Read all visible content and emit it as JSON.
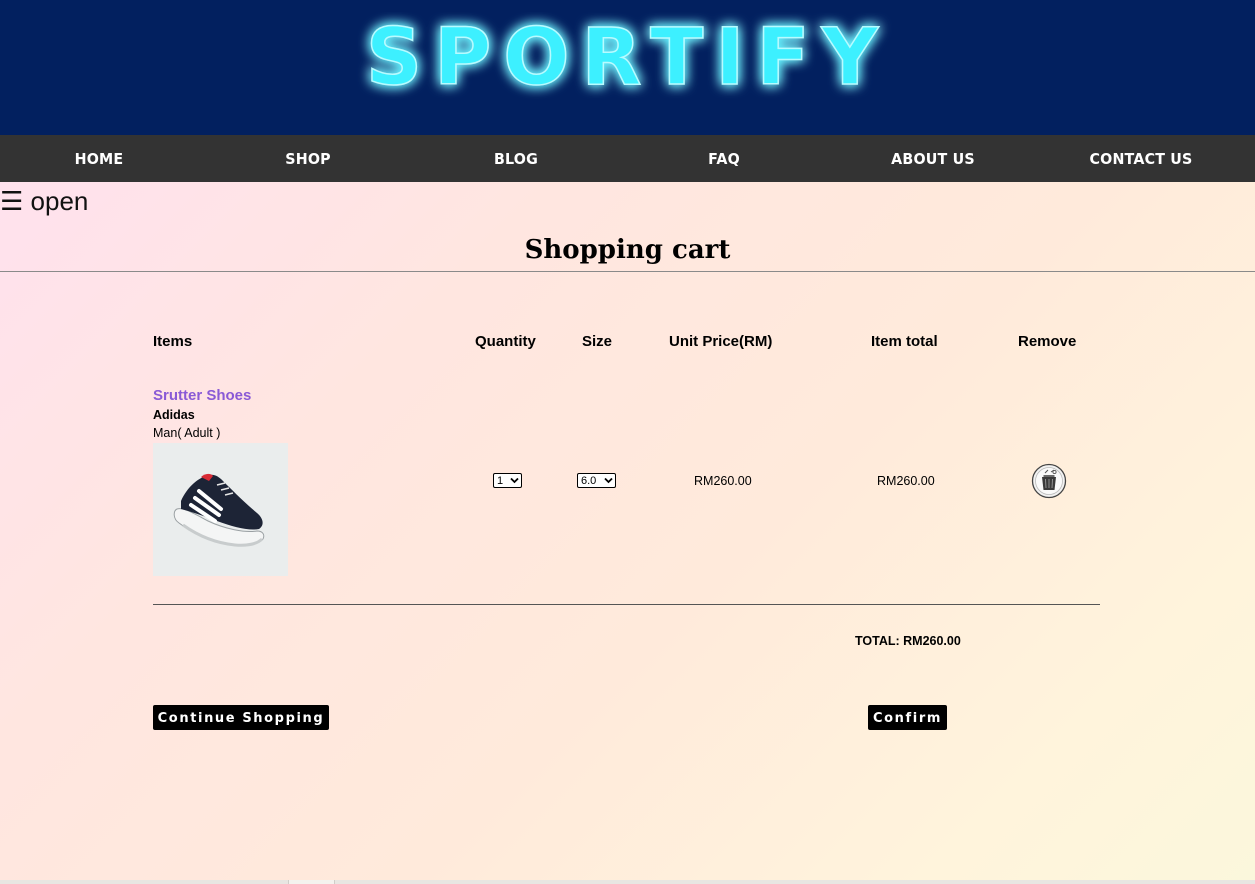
{
  "header": {
    "brand_logo_text": "SPORTIFY",
    "background_color": "#02205f",
    "logo_color": "#3ef0ff"
  },
  "nav": {
    "items": [
      {
        "label": "HOME"
      },
      {
        "label": "SHOP"
      },
      {
        "label": "BLOG"
      },
      {
        "label": "FAQ"
      },
      {
        "label": "ABOUT US"
      },
      {
        "label": "CONTACT US"
      }
    ],
    "background_color": "#333333"
  },
  "sidebar_toggle": {
    "label": "☰ open"
  },
  "page": {
    "title": "Shopping cart"
  },
  "cart": {
    "columns": [
      "Items",
      "Quantity",
      "Size",
      "Unit Price(RM)",
      "Item total",
      "Remove"
    ],
    "items": [
      {
        "name": "Srutter Shoes",
        "brand": "Adidas",
        "category": "Man( Adult )",
        "image_icon": "sneaker-image",
        "quantity": "1",
        "size": "6.0",
        "unit_price": "RM260.00",
        "item_total": "RM260.00",
        "remove_icon": "trash-bin-icon"
      }
    ],
    "total_text": "TOTAL: RM260.00",
    "continue_label": "Continue Shopping",
    "confirm_label": "Confirm",
    "accent_color": "#8a5ad6"
  }
}
